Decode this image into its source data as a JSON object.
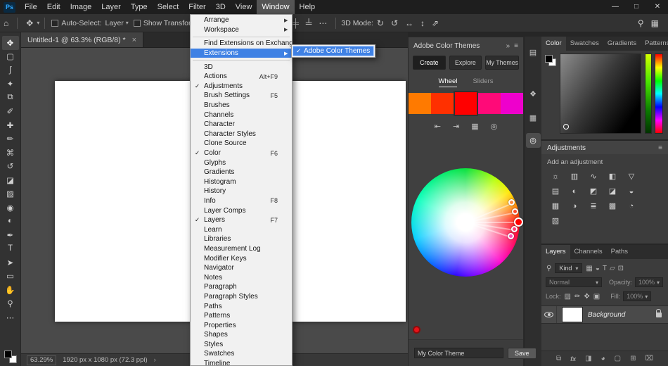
{
  "titlebar": {
    "logo": "Ps",
    "menus": [
      {
        "name": "menubar-item-file",
        "label": "File"
      },
      {
        "name": "menubar-item-edit",
        "label": "Edit"
      },
      {
        "name": "menubar-item-image",
        "label": "Image"
      },
      {
        "name": "menubar-item-layer",
        "label": "Layer"
      },
      {
        "name": "menubar-item-type",
        "label": "Type"
      },
      {
        "name": "menubar-item-select",
        "label": "Select"
      },
      {
        "name": "menubar-item-filter",
        "label": "Filter"
      },
      {
        "name": "menubar-item-3d",
        "label": "3D"
      },
      {
        "name": "menubar-item-view",
        "label": "View"
      },
      {
        "name": "menubar-item-window",
        "label": "Window",
        "class": "active"
      },
      {
        "name": "menubar-item-help",
        "label": "Help"
      }
    ],
    "minimize": "—",
    "maximize": "□",
    "close": "✕"
  },
  "options": {
    "home_icon": "⌂",
    "tool_icon": "✥",
    "caret": "▾",
    "auto_select_label": "Auto-Select:",
    "auto_select_value": "Layer",
    "show_transform_label": "Show Transform Controls",
    "align_icons": [
      {
        "name": "align-left-icon",
        "glyph": "╟"
      },
      {
        "name": "align-center-horizontal-icon",
        "glyph": "╫"
      },
      {
        "name": "align-right-icon",
        "glyph": "╢"
      },
      {
        "name": "align-top-icon",
        "glyph": "╤"
      },
      {
        "name": "align-middle-icon",
        "glyph": "╪"
      },
      {
        "name": "align-bottom-icon",
        "glyph": "╧"
      }
    ],
    "more_icon": "⋯",
    "mode_label": "3D Mode:",
    "mode_icons": [
      {
        "name": "orbit-3d-icon",
        "glyph": "↻"
      },
      {
        "name": "roll-3d-icon",
        "glyph": "↺"
      },
      {
        "name": "drag-3d-icon",
        "glyph": "↔"
      },
      {
        "name": "slide-3d-icon",
        "glyph": "↕"
      },
      {
        "name": "scale-3d-icon",
        "glyph": "⇗"
      }
    ],
    "search_icon": "⚲",
    "workspace_icon": "▦"
  },
  "tab": {
    "title": "Untitled-1 @ 63.3% (RGB/8) *",
    "close": "×"
  },
  "tools": [
    {
      "name": "move-tool",
      "glyph": "✥",
      "class": "active"
    },
    {
      "name": "marquee-tool",
      "glyph": "▢"
    },
    {
      "name": "lasso-tool",
      "glyph": "ʃ"
    },
    {
      "name": "quick-selection-tool",
      "glyph": "✦"
    },
    {
      "name": "crop-tool",
      "glyph": "⧉"
    },
    {
      "name": "eyedropper-tool",
      "glyph": "✐"
    },
    {
      "name": "healing-brush-tool",
      "glyph": "✚"
    },
    {
      "name": "brush-tool",
      "glyph": "✏"
    },
    {
      "name": "clone-stamp-tool",
      "glyph": "⌘"
    },
    {
      "name": "history-brush-tool",
      "glyph": "↺"
    },
    {
      "name": "eraser-tool",
      "glyph": "◪"
    },
    {
      "name": "gradient-tool",
      "glyph": "▨"
    },
    {
      "name": "blur-tool",
      "glyph": "◉"
    },
    {
      "name": "dodge-tool",
      "glyph": "◐"
    },
    {
      "name": "pen-tool",
      "glyph": "✒"
    },
    {
      "name": "type-tool",
      "glyph": "T"
    },
    {
      "name": "path-selection-tool",
      "glyph": "➤"
    },
    {
      "name": "rectangle-tool",
      "glyph": "▭"
    },
    {
      "name": "hand-tool",
      "glyph": "✋"
    },
    {
      "name": "zoom-tool",
      "glyph": "⚲"
    },
    {
      "name": "edit-toolbar-button",
      "glyph": "⋯"
    }
  ],
  "menu": {
    "items": [
      {
        "name": "menu-item-arrange",
        "label": "Arrange",
        "arrow": "▶"
      },
      {
        "name": "menu-item-workspace",
        "label": "Workspace",
        "arrow": "▶"
      },
      {
        "name": "menu-separator",
        "class": "separator",
        "interactable": false
      },
      {
        "name": "menu-item-find-extensions",
        "label": "Find Extensions on Exchange..."
      },
      {
        "name": "menu-item-extensions",
        "label": "Extensions",
        "arrow": "▶",
        "class": "highlight"
      },
      {
        "name": "menu-separator",
        "class": "separator",
        "interactable": false
      },
      {
        "name": "menu-item-3d",
        "label": "3D"
      },
      {
        "name": "menu-item-actions",
        "label": "Actions",
        "shortcut": "Alt+F9"
      },
      {
        "name": "menu-item-adjustments",
        "label": "Adjustments",
        "check": "✓"
      },
      {
        "name": "menu-item-brush-settings",
        "label": "Brush Settings",
        "shortcut": "F5"
      },
      {
        "name": "menu-item-brushes",
        "label": "Brushes"
      },
      {
        "name": "menu-item-channels",
        "label": "Channels"
      },
      {
        "name": "menu-item-character",
        "label": "Character"
      },
      {
        "name": "menu-item-character-styles",
        "label": "Character Styles"
      },
      {
        "name": "menu-item-clone-source",
        "label": "Clone Source"
      },
      {
        "name": "menu-item-color",
        "label": "Color",
        "check": "✓",
        "shortcut": "F6"
      },
      {
        "name": "menu-item-glyphs",
        "label": "Glyphs"
      },
      {
        "name": "menu-item-gradients",
        "label": "Gradients"
      },
      {
        "name": "menu-item-histogram",
        "label": "Histogram"
      },
      {
        "name": "menu-item-history",
        "label": "History"
      },
      {
        "name": "menu-item-info",
        "label": "Info",
        "shortcut": "F8"
      },
      {
        "name": "menu-item-layer-comps",
        "label": "Layer Comps"
      },
      {
        "name": "menu-item-layers",
        "label": "Layers",
        "check": "✓",
        "shortcut": "F7"
      },
      {
        "name": "menu-item-learn",
        "label": "Learn"
      },
      {
        "name": "menu-item-libraries",
        "label": "Libraries"
      },
      {
        "name": "menu-item-measurement-log",
        "label": "Measurement Log"
      },
      {
        "name": "menu-item-modifier-keys",
        "label": "Modifier Keys"
      },
      {
        "name": "menu-item-navigator",
        "label": "Navigator"
      },
      {
        "name": "menu-item-notes",
        "label": "Notes"
      },
      {
        "name": "menu-item-paragraph",
        "label": "Paragraph"
      },
      {
        "name": "menu-item-paragraph-styles",
        "label": "Paragraph Styles"
      },
      {
        "name": "menu-item-paths",
        "label": "Paths"
      },
      {
        "name": "menu-item-patterns",
        "label": "Patterns"
      },
      {
        "name": "menu-item-properties",
        "label": "Properties"
      },
      {
        "name": "menu-item-shapes",
        "label": "Shapes"
      },
      {
        "name": "menu-item-styles",
        "label": "Styles"
      },
      {
        "name": "menu-item-swatches",
        "label": "Swatches"
      },
      {
        "name": "menu-item-timeline",
        "label": "Timeline"
      }
    ]
  },
  "submenu": {
    "check": "✓",
    "label": "Adobe Color Themes"
  },
  "color_themes": {
    "title": "Adobe Color Themes",
    "collapse_icon": "»",
    "menu_icon": "≡",
    "tabs": [
      {
        "name": "ct-tab-create",
        "label": "Create",
        "class": "active"
      },
      {
        "name": "ct-tab-explore",
        "label": "Explore"
      },
      {
        "name": "ct-tab-my-themes",
        "label": "My Themes"
      }
    ],
    "modes": [
      {
        "name": "ct-mode-wheel",
        "label": "Wheel",
        "class": "active"
      },
      {
        "name": "ct-mode-sliders",
        "label": "Sliders"
      }
    ],
    "swatches": [
      {
        "name": "theme-swatch-1",
        "color": "#FF7A00"
      },
      {
        "name": "theme-swatch-2",
        "color": "#FF3000"
      },
      {
        "name": "theme-swatch-3",
        "color": "#FF0000",
        "class": "selected"
      },
      {
        "name": "theme-swatch-4",
        "color": "#FF0A78"
      },
      {
        "name": "theme-swatch-5",
        "color": "#EE00CC"
      }
    ],
    "actions": [
      {
        "name": "adjust-left-icon",
        "glyph": "⇤"
      },
      {
        "name": "adjust-right-icon",
        "glyph": "⇥"
      },
      {
        "name": "grid-view-icon",
        "glyph": "▦"
      },
      {
        "name": "color-rule-icon",
        "glyph": "◎"
      }
    ],
    "theme_name": "My Color Theme",
    "save_label": "Save",
    "accent_red": "#FF0000"
  },
  "dock_icons": [
    {
      "name": "history-panel-icon",
      "glyph": "▤"
    },
    {
      "name": "navigator-panel-icon",
      "glyph": "❖"
    },
    {
      "name": "libraries-panel-icon",
      "glyph": "▦"
    },
    {
      "name": "color-themes-panel-icon",
      "glyph": "◎",
      "class": "active"
    }
  ],
  "color_panel": {
    "tabs": [
      {
        "name": "tab-color",
        "label": "Color",
        "class": "active"
      },
      {
        "name": "tab-swatches",
        "label": "Swatches"
      },
      {
        "name": "tab-gradients",
        "label": "Gradients"
      },
      {
        "name": "tab-patterns",
        "label": "Patterns"
      }
    ]
  },
  "adjustments": {
    "title": "Adjustments",
    "menu_icon": "≡",
    "subtitle": "Add an adjustment",
    "icons": [
      {
        "name": "brightness-contrast-icon",
        "glyph": "☼"
      },
      {
        "name": "levels-icon",
        "glyph": "▥"
      },
      {
        "name": "curves-icon",
        "glyph": "∿"
      },
      {
        "name": "exposure-icon",
        "glyph": "◧"
      },
      {
        "name": "vibrance-icon",
        "glyph": "▽"
      },
      {
        "name": "hue-saturation-icon",
        "glyph": "▤"
      },
      {
        "name": "color-balance-icon",
        "glyph": "◐"
      },
      {
        "name": "black-white-icon",
        "glyph": "◩"
      },
      {
        "name": "photo-filter-icon",
        "glyph": "◪"
      },
      {
        "name": "channel-mixer-icon",
        "glyph": "◒"
      },
      {
        "name": "color-lookup-icon",
        "glyph": "▦"
      },
      {
        "name": "invert-icon",
        "glyph": "◑"
      },
      {
        "name": "posterize-icon",
        "glyph": "≣"
      },
      {
        "name": "threshold-icon",
        "glyph": "▩"
      },
      {
        "name": "selective-color-icon",
        "glyph": "◔"
      },
      {
        "name": "gradient-map-icon",
        "glyph": "▧"
      }
    ]
  },
  "layers_panel": {
    "tabs": [
      {
        "name": "tab-layers",
        "label": "Layers",
        "class": "active"
      },
      {
        "name": "tab-channels",
        "label": "Channels"
      },
      {
        "name": "tab-paths",
        "label": "Paths"
      }
    ],
    "search_icon": "⚲",
    "kind_label": "Kind",
    "caret": "▾",
    "filter_icons": [
      {
        "name": "filter-pixel-icon",
        "glyph": "▦"
      },
      {
        "name": "filter-adjustment-icon",
        "glyph": "◒"
      },
      {
        "name": "filter-type-icon",
        "glyph": "T"
      },
      {
        "name": "filter-shape-icon",
        "glyph": "▱"
      },
      {
        "name": "filter-smart-object-icon",
        "glyph": "⊡"
      }
    ],
    "blend_mode": "Normal",
    "opacity_label": "Opacity:",
    "opacity_value": "100%",
    "lock_label": "Lock:",
    "lock_icons": [
      {
        "name": "lock-transparency-icon",
        "glyph": "▨"
      },
      {
        "name": "lock-image-icon",
        "glyph": "✏"
      },
      {
        "name": "lock-position-icon",
        "glyph": "✥"
      },
      {
        "name": "lock-all-icon",
        "glyph": "▣"
      }
    ],
    "fill_label": "Fill:",
    "fill_value": "100%",
    "layer": {
      "name": "Background"
    },
    "bottom_icons": [
      {
        "name": "link-layers-icon",
        "glyph": "⧉"
      },
      {
        "name": "layer-effects-icon",
        "glyph": "fx",
        "class": "lpb-fx"
      },
      {
        "name": "layer-mask-icon",
        "glyph": "◨"
      },
      {
        "name": "adjustment-layer-icon",
        "glyph": "◕"
      },
      {
        "name": "layer-group-icon",
        "glyph": "▢"
      },
      {
        "name": "new-layer-icon",
        "glyph": "⊞"
      },
      {
        "name": "delete-layer-icon",
        "glyph": "⌧"
      }
    ]
  },
  "status": {
    "zoom": "63.29%",
    "info": "1920 px x 1080 px (72.3 ppi)",
    "chevron": "›"
  }
}
